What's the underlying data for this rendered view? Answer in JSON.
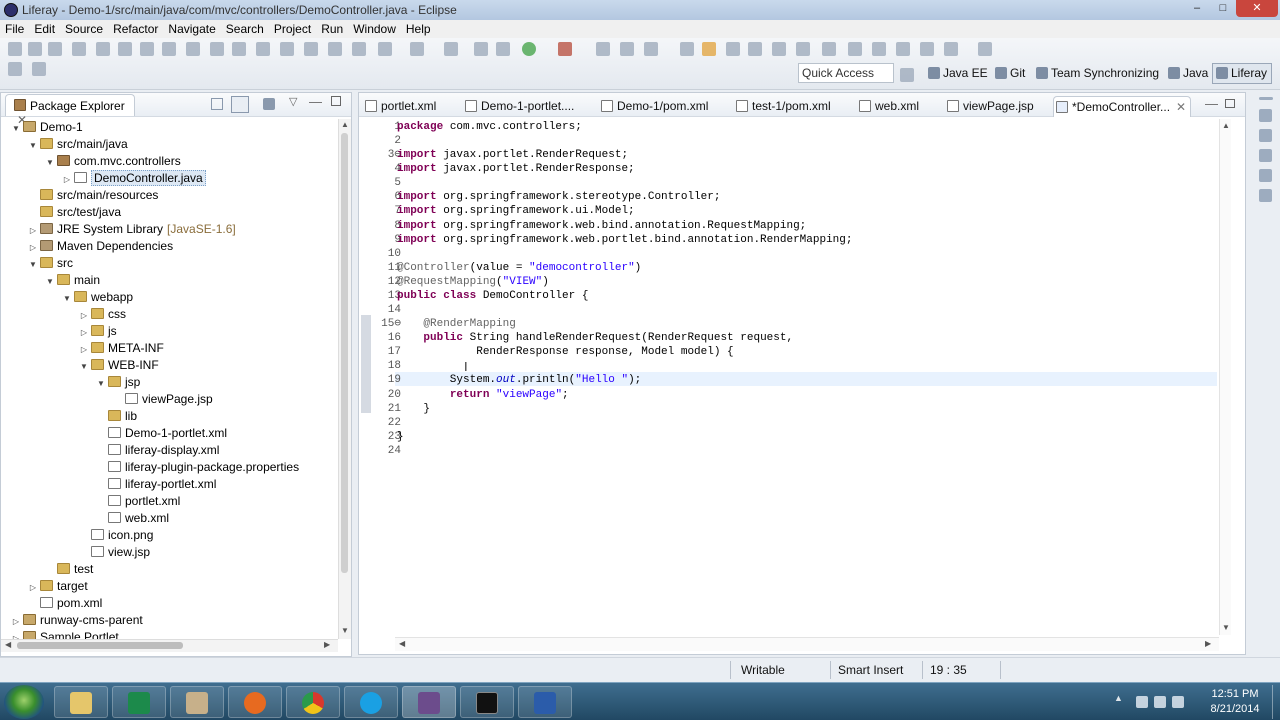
{
  "window": {
    "title": "Liferay - Demo-1/src/main/java/com/mvc/controllers/DemoController.java - Eclipse",
    "controls": [
      "–",
      "□",
      "✕"
    ]
  },
  "menu": [
    "File",
    "Edit",
    "Source",
    "Refactor",
    "Navigate",
    "Search",
    "Project",
    "Run",
    "Window",
    "Help"
  ],
  "toolbar": {
    "quick_access_placeholder": "Quick Access",
    "perspectives": [
      "Java EE",
      "Git",
      "Team Synchronizing",
      "Java",
      "Liferay"
    ],
    "active_perspective": "Liferay"
  },
  "package_explorer": {
    "title": "Package Explorer",
    "items": [
      {
        "label": "Demo-1",
        "indent": 0,
        "arrow": "▼",
        "icon": "project"
      },
      {
        "label": "src/main/java",
        "indent": 1,
        "arrow": "▼",
        "icon": "folder"
      },
      {
        "label": "com.mvc.controllers",
        "indent": 2,
        "arrow": "▼",
        "icon": "package"
      },
      {
        "label": "DemoController.java",
        "indent": 3,
        "arrow": "▷",
        "icon": "file",
        "selected": true
      },
      {
        "label": "src/main/resources",
        "indent": 1,
        "arrow": "",
        "icon": "folder"
      },
      {
        "label": "src/test/java",
        "indent": 1,
        "arrow": "",
        "icon": "folder"
      },
      {
        "label": "JRE System Library",
        "suffix": "[JavaSE-1.6]",
        "indent": 1,
        "arrow": "▷",
        "icon": "library"
      },
      {
        "label": "Maven Dependencies",
        "indent": 1,
        "arrow": "▷",
        "icon": "library"
      },
      {
        "label": "src",
        "indent": 1,
        "arrow": "▼",
        "icon": "folder"
      },
      {
        "label": "main",
        "indent": 2,
        "arrow": "▼",
        "icon": "folder"
      },
      {
        "label": "webapp",
        "indent": 3,
        "arrow": "▼",
        "icon": "folder"
      },
      {
        "label": "css",
        "indent": 4,
        "arrow": "▷",
        "icon": "folder"
      },
      {
        "label": "js",
        "indent": 4,
        "arrow": "▷",
        "icon": "folder"
      },
      {
        "label": "META-INF",
        "indent": 4,
        "arrow": "▷",
        "icon": "folder"
      },
      {
        "label": "WEB-INF",
        "indent": 4,
        "arrow": "▼",
        "icon": "folder"
      },
      {
        "label": "jsp",
        "indent": 5,
        "arrow": "▼",
        "icon": "folder"
      },
      {
        "label": "viewPage.jsp",
        "indent": 6,
        "arrow": "",
        "icon": "file"
      },
      {
        "label": "lib",
        "indent": 5,
        "arrow": "",
        "icon": "folder"
      },
      {
        "label": "Demo-1-portlet.xml",
        "indent": 5,
        "arrow": "",
        "icon": "file"
      },
      {
        "label": "liferay-display.xml",
        "indent": 5,
        "arrow": "",
        "icon": "file"
      },
      {
        "label": "liferay-plugin-package.properties",
        "indent": 5,
        "arrow": "",
        "icon": "file"
      },
      {
        "label": "liferay-portlet.xml",
        "indent": 5,
        "arrow": "",
        "icon": "file"
      },
      {
        "label": "portlet.xml",
        "indent": 5,
        "arrow": "",
        "icon": "file"
      },
      {
        "label": "web.xml",
        "indent": 5,
        "arrow": "",
        "icon": "file"
      },
      {
        "label": "icon.png",
        "indent": 4,
        "arrow": "",
        "icon": "file"
      },
      {
        "label": "view.jsp",
        "indent": 4,
        "arrow": "",
        "icon": "file"
      },
      {
        "label": "test",
        "indent": 2,
        "arrow": "",
        "icon": "folder"
      },
      {
        "label": "target",
        "indent": 1,
        "arrow": "▷",
        "icon": "folder"
      },
      {
        "label": "pom.xml",
        "indent": 1,
        "arrow": "",
        "icon": "file"
      },
      {
        "label": "runway-cms-parent",
        "indent": 0,
        "arrow": "▷",
        "icon": "project"
      },
      {
        "label": "Sample Portlet",
        "indent": 0,
        "arrow": "▷",
        "icon": "project"
      }
    ]
  },
  "editor": {
    "tabs": [
      {
        "label": "portlet.xml"
      },
      {
        "label": "Demo-1-portlet...."
      },
      {
        "label": "Demo-1/pom.xml"
      },
      {
        "label": "test-1/pom.xml"
      },
      {
        "label": "web.xml"
      },
      {
        "label": "viewPage.jsp"
      },
      {
        "label": "*DemoController...",
        "active": true
      }
    ],
    "lines": [
      {
        "n": "1",
        "html": "<span class=\"kw\">package</span> com.mvc.controllers;"
      },
      {
        "n": "2",
        "html": ""
      },
      {
        "n": "3⊖",
        "html": "<span class=\"kw\">import</span> javax.portlet.RenderRequest;"
      },
      {
        "n": "4",
        "html": "<span class=\"kw\">import</span> javax.portlet.RenderResponse;"
      },
      {
        "n": "5",
        "html": ""
      },
      {
        "n": "6",
        "html": "<span class=\"kw\">import</span> org.springframework.stereotype.Controller;"
      },
      {
        "n": "7",
        "html": "<span class=\"kw\">import</span> org.springframework.ui.Model;"
      },
      {
        "n": "8",
        "html": "<span class=\"kw\">import</span> org.springframework.web.bind.annotation.RequestMapping;"
      },
      {
        "n": "9",
        "html": "<span class=\"kw\">import</span> org.springframework.web.portlet.bind.annotation.RenderMapping;"
      },
      {
        "n": "10",
        "html": ""
      },
      {
        "n": "11",
        "html": "<span class=\"an\">@Controller</span>(value = <span class=\"st\">\"democontroller\"</span>)"
      },
      {
        "n": "12",
        "html": "<span class=\"an\">@RequestMapping</span>(<span class=\"st\">\"VIEW\"</span>)"
      },
      {
        "n": "13",
        "html": "<span class=\"kw\">public class</span> DemoController {"
      },
      {
        "n": "14",
        "html": ""
      },
      {
        "n": "15⊖",
        "html": "    <span class=\"an\">@RenderMapping</span>"
      },
      {
        "n": "16",
        "html": "    <span class=\"kw\">public</span> String handleRenderRequest(RenderRequest request,"
      },
      {
        "n": "17",
        "html": "            RenderResponse response, Model model) {"
      },
      {
        "n": "18",
        "html": ""
      },
      {
        "n": "19",
        "html": "        System.<span class=\"fld\">out</span>.println(<span class=\"st\">\"Hello \"</span>);"
      },
      {
        "n": "20",
        "html": "        <span class=\"kw\">return</span> <span class=\"st\">\"viewPage\"</span>;"
      },
      {
        "n": "21",
        "html": "    }"
      },
      {
        "n": "22",
        "html": ""
      },
      {
        "n": "23",
        "html": "}"
      },
      {
        "n": "24",
        "html": ""
      }
    ]
  },
  "status": {
    "writable": "Writable",
    "insert_mode": "Smart Insert",
    "position": "19 : 35"
  },
  "taskbar": {
    "time": "12:51 PM",
    "date": "8/21/2014",
    "apps": [
      "explorer",
      "captivate",
      "media",
      "firefox",
      "chrome",
      "skype",
      "eclipse",
      "cmd",
      "word"
    ]
  }
}
